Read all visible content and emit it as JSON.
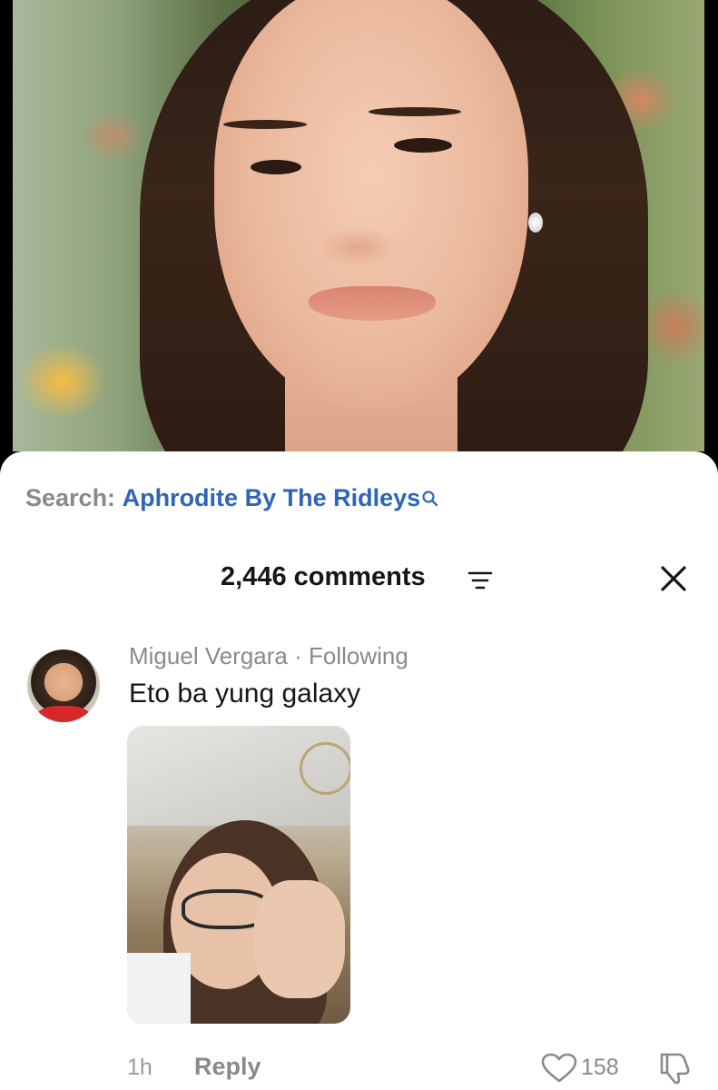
{
  "search": {
    "prefix": "Search:",
    "term": "Aphrodite By The Ridleys"
  },
  "comments_header": {
    "count_label": "2,446 comments"
  },
  "comment": {
    "author": "Miguel Vergara",
    "separator": " · ",
    "relation": "Following",
    "text": "Eto ba yung galaxy",
    "time": "1h",
    "reply_label": "Reply",
    "like_count": "158"
  },
  "icons": {
    "search": "search-icon",
    "filter": "filter-icon",
    "close": "close-icon",
    "like": "heart-icon",
    "dislike": "thumbs-down-icon"
  },
  "colors": {
    "link": "#2f65b9",
    "muted": "#8a8a8a",
    "text": "#161616"
  }
}
